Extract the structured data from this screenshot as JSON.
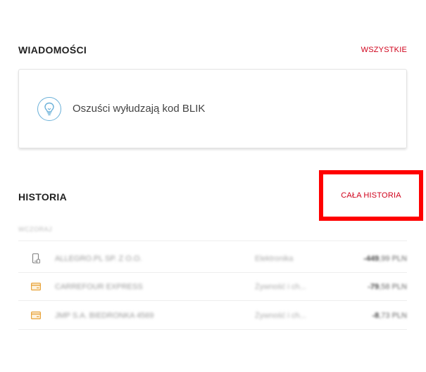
{
  "messages": {
    "title": "WIADOMOŚCI",
    "all_link": "WSZYSTKIE",
    "item": {
      "icon": "lightbulb-icon",
      "text": "Oszuści wyłudzają kod BLIK"
    }
  },
  "history": {
    "title": "HISTORIA",
    "all_link": "CAŁA HISTORIA",
    "subheader": "WCZORAJ",
    "rows": [
      {
        "icon": "phone-icon",
        "name": "ALLEGRO.PL SP. Z O.O.",
        "category": "Elektronika",
        "amount_main": "-449",
        "amount_suffix": ",99 PLN"
      },
      {
        "icon": "card-icon",
        "name": "CARREFOUR EXPRESS",
        "category": "Żywność i ch...",
        "amount_main": "-79",
        "amount_suffix": ",58 PLN"
      },
      {
        "icon": "card-icon",
        "name": "JMP S.A. BIEDRONKA 4569",
        "category": "Żywność i ch...",
        "amount_main": "-8",
        "amount_suffix": ",73 PLN"
      }
    ]
  },
  "colors": {
    "accent_red": "#d0021b",
    "highlight_box": "#ff0000",
    "icon_blue": "#6ab0d8",
    "card_icon_orange": "#e8a33a"
  }
}
